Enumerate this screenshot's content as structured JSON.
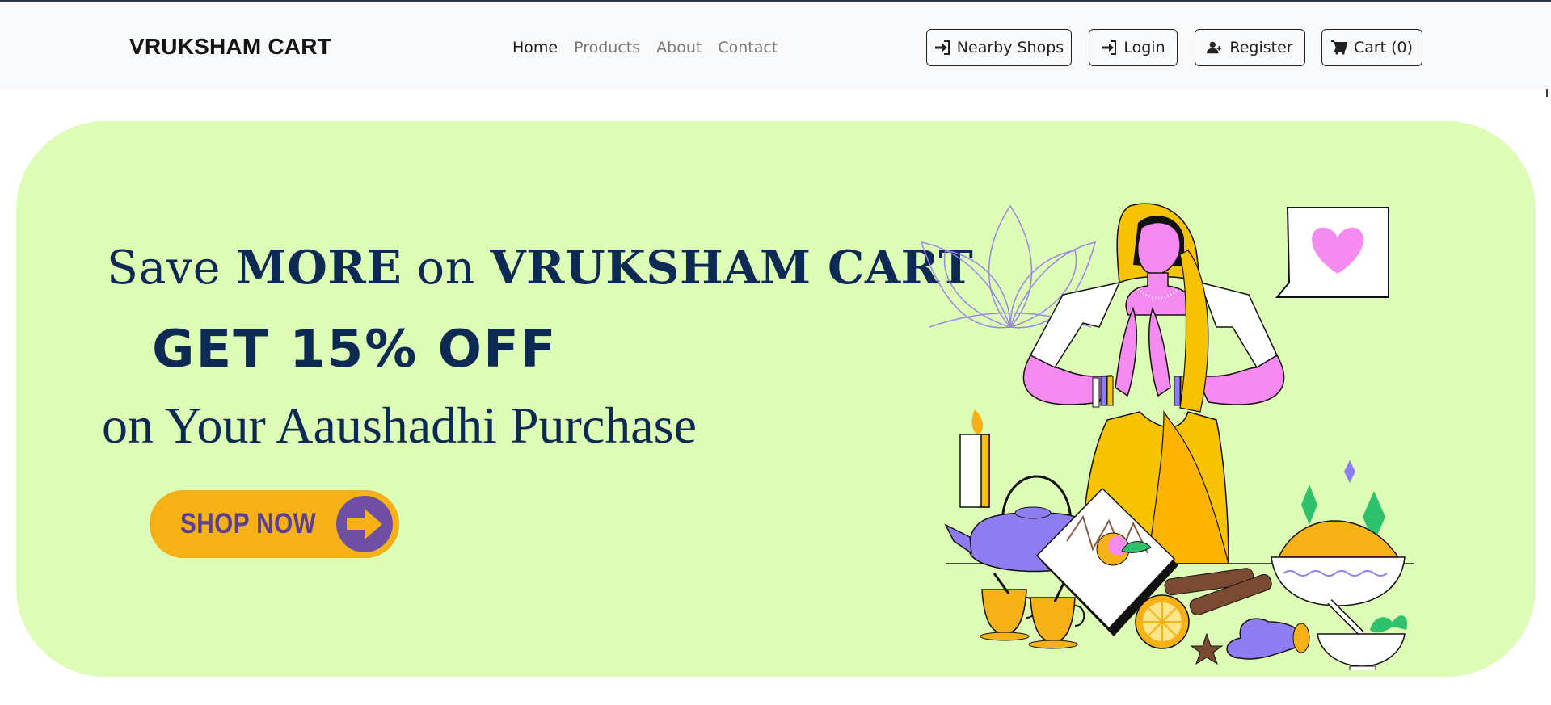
{
  "navbar": {
    "brand": "VRUKSHAM CART",
    "links": [
      {
        "label": "Home",
        "active": true
      },
      {
        "label": "Products",
        "active": false
      },
      {
        "label": "About",
        "active": false
      },
      {
        "label": "Contact",
        "active": false
      }
    ],
    "buttons": {
      "nearby": "Nearby Shops",
      "login": "Login",
      "register": "Register",
      "cart": "Cart (0)"
    }
  },
  "hero": {
    "line1_a": "Save ",
    "line1_b": "MORE",
    "line1_c": " on ",
    "line1_d": "VRUKSHAM CART",
    "line2": "GET 15% OFF",
    "line3": "on Your Aaushadhi Purchase",
    "cta": "SHOP NOW"
  },
  "colors": {
    "hero_bg": "#ddfcb5",
    "navy": "#0d2a55",
    "cta_bg": "#f6b117",
    "cta_text": "#5c3f92",
    "navbar_bg": "#f8f9fa"
  },
  "icons": {
    "nearby": "sign-in-icon",
    "login": "sign-in-icon",
    "register": "user-plus-icon",
    "cart": "shopping-cart-icon",
    "cta": "arrow-right-icon"
  }
}
